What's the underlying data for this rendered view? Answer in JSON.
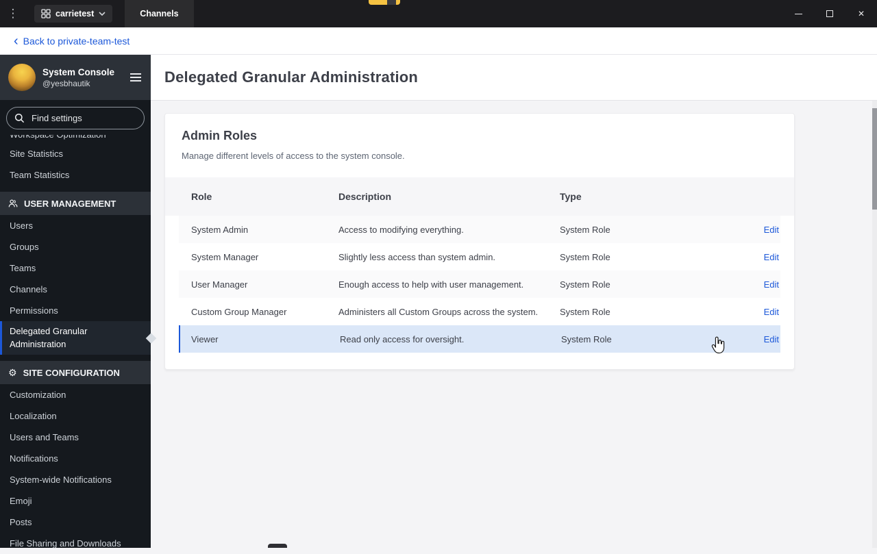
{
  "icons": {
    "kebab_menu": "⋮",
    "close": "✕",
    "gear": "⚙",
    "back_chevron": "‹"
  },
  "colors": {
    "accent_blue": "#1c58d9",
    "selected_row_bg": "#dbe7f8",
    "indicator_yellow": "#f5c242",
    "sidebar_bg": "#15191e",
    "titlebar_bg": "#1c1c1f"
  },
  "titlebar": {
    "team_name": "carrietest",
    "tab_label": "Channels"
  },
  "back_link": {
    "label": "Back to private-team-test"
  },
  "sidebar": {
    "title": "System Console",
    "subtitle": "@yesbhautik",
    "search_placeholder": "Find settings",
    "items_top": [
      {
        "label": "Workspace Optimization",
        "partial": true
      },
      {
        "label": "Site Statistics"
      },
      {
        "label": "Team Statistics"
      }
    ],
    "sections": [
      {
        "label": "USER MANAGEMENT",
        "icon": "people-icon",
        "items": [
          "Users",
          "Groups",
          "Teams",
          "Channels",
          "Permissions",
          "Delegated Granular Administration"
        ]
      },
      {
        "label": "SITE CONFIGURATION",
        "icon": "gear-icon",
        "items": [
          "Customization",
          "Localization",
          "Users and Teams",
          "Notifications",
          "System-wide Notifications",
          "Emoji",
          "Posts",
          "File Sharing and Downloads"
        ]
      }
    ],
    "active_item": "Delegated Granular Administration"
  },
  "main": {
    "page_title": "Delegated Granular Administration",
    "card": {
      "title": "Admin Roles",
      "description": "Manage different levels of access to the system console.",
      "table": {
        "columns": [
          "Role",
          "Description",
          "Type"
        ],
        "action_label": "Edit",
        "rows": [
          {
            "role": "System Admin",
            "description": "Access to modifying everything.",
            "type": "System Role"
          },
          {
            "role": "System Manager",
            "description": "Slightly less access than system admin.",
            "type": "System Role"
          },
          {
            "role": "User Manager",
            "description": "Enough access to help with user management.",
            "type": "System Role"
          },
          {
            "role": "Custom Group Manager",
            "description": "Administers all Custom Groups across the system.",
            "type": "System Role"
          },
          {
            "role": "Viewer",
            "description": "Read only access for oversight.",
            "type": "System Role",
            "selected": true
          }
        ]
      }
    }
  }
}
